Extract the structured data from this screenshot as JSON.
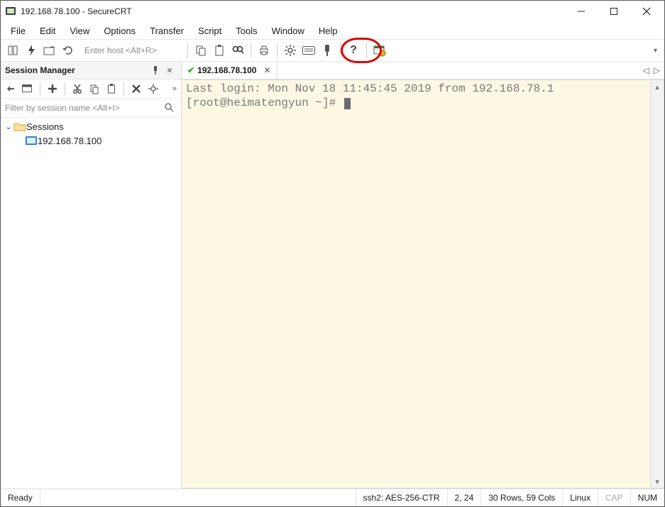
{
  "window": {
    "title": "192.168.78.100 - SecureCRT"
  },
  "menu": {
    "items": [
      "File",
      "Edit",
      "View",
      "Options",
      "Transfer",
      "Script",
      "Tools",
      "Window",
      "Help"
    ]
  },
  "toolbar": {
    "host_placeholder": "Enter host <Alt+R>",
    "icons": {
      "session_manager": "session-manager-icon",
      "quick_connect": "lightning-icon",
      "connect_in_tab": "connect-tab-icon",
      "reconnect": "reconnect-icon",
      "copy": "copy-icon",
      "paste": "paste-icon",
      "find": "find-icon",
      "print": "print-icon",
      "options": "gear-icon",
      "keyboard": "keyboard-icon",
      "keymap": "keymap-icon",
      "help": "help-icon",
      "securefx": "securefx-icon"
    }
  },
  "session_manager": {
    "title": "Session Manager",
    "filter_placeholder": "Filter by session name <Alt+I>",
    "root_label": "Sessions",
    "items": [
      {
        "label": "192.168.78.100"
      }
    ]
  },
  "tabs": {
    "active": {
      "label": "192.168.78.100"
    }
  },
  "terminal": {
    "line1": "Last login: Mon Nov 18 11:45:45 2019 from 192.168.78.1",
    "prompt": "[root@heimatengyun ~]# "
  },
  "status": {
    "ready": "Ready",
    "protocol": "ssh2: AES-256-CTR",
    "cursor_pos": "2,  24",
    "dimensions": "30 Rows, 59 Cols",
    "mode": "Linux",
    "cap": "CAP",
    "num": "NUM"
  }
}
